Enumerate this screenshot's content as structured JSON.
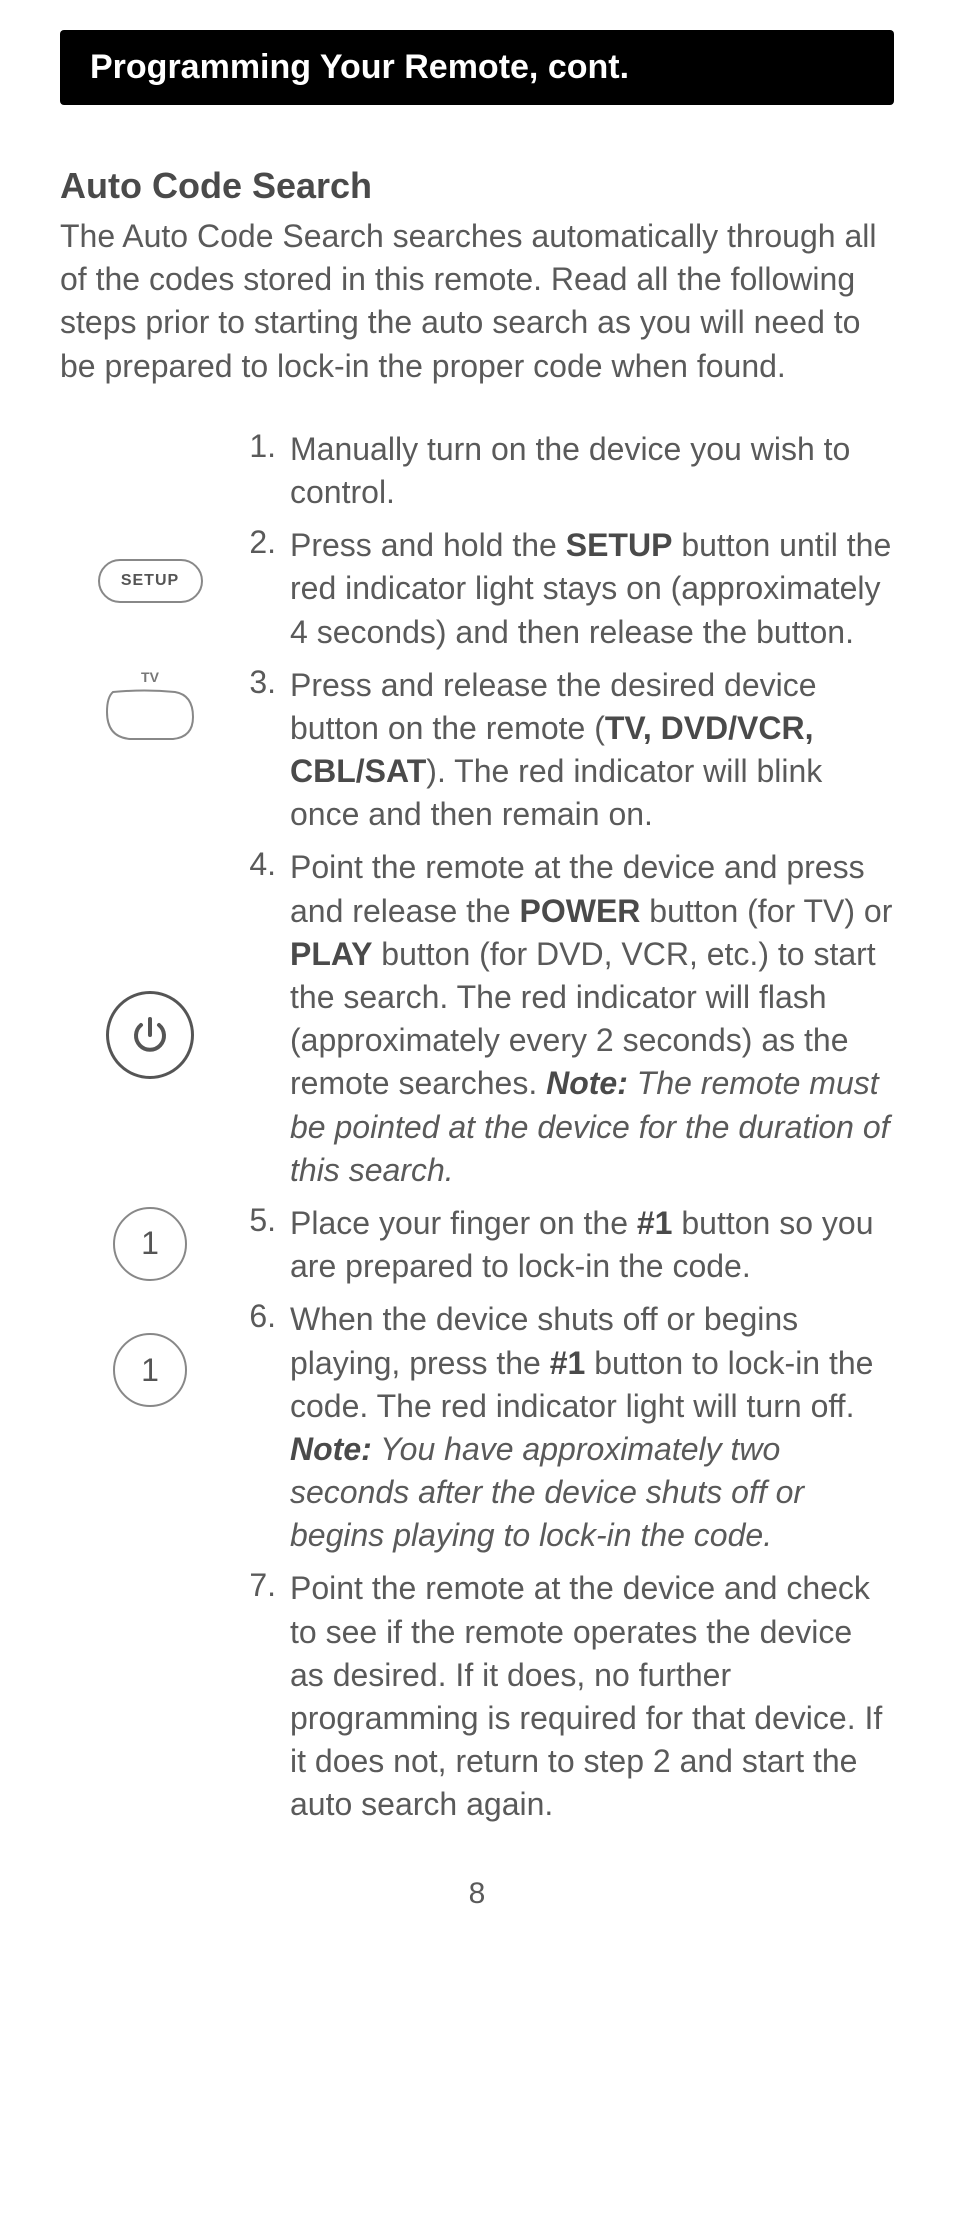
{
  "header": {
    "title": "Programming Your Remote, cont."
  },
  "section": {
    "title": "Auto Code Search",
    "intro": "The Auto Code Search searches automatically through all of the codes stored in this remote. Read all the following steps prior to starting the auto search as you will need to be prepared to lock-in the proper code when found."
  },
  "icons": {
    "setup_label": "SETUP",
    "tv_label": "TV",
    "one_label": "1"
  },
  "steps": {
    "s1": {
      "num": "1.",
      "text": "Manually turn on the device you wish to control."
    },
    "s2": {
      "num": "2.",
      "pre": "Press and hold the ",
      "b1": "SETUP",
      "post": " button until the red indicator light stays on (approximately 4 seconds) and then release the button."
    },
    "s3": {
      "num": "3.",
      "pre": "Press and release the desired device button on the remote (",
      "b1": "TV, DVD/VCR, CBL/SAT",
      "post": "). The red indicator will blink once and then remain on."
    },
    "s4": {
      "num": "4.",
      "t1": "Point the remote at the device and press and release the ",
      "b1": "POWER",
      "t2": " button (for TV) or ",
      "b2": "PLAY",
      "t3": " button (for DVD, VCR, etc.) to start the search. The red indicator will flash (approximately every 2 seconds) as the remote searches. ",
      "notelabel": "Note:",
      "note": " The remote must be pointed at the device for the duration of this search."
    },
    "s5": {
      "num": "5.",
      "t1": "Place your finger on the ",
      "b1": "#1",
      "t2": " button so you are prepared to lock-in the code."
    },
    "s6": {
      "num": "6.",
      "t1": "When the device shuts off or begins playing, press the ",
      "b1": "#1",
      "t2": " button to lock-in the code.  The red indicator light will turn off. ",
      "notelabel": "Note:",
      "note": "  You have approximately two seconds after the device shuts off or begins playing to lock-in the code."
    },
    "s7": {
      "num": "7.",
      "text": "Point the remote at the device and check to see if the remote operates the device as desired. If it does, no further programming is required for that device. If it does not, return to step 2 and start the auto search again."
    }
  },
  "page_number": "8"
}
